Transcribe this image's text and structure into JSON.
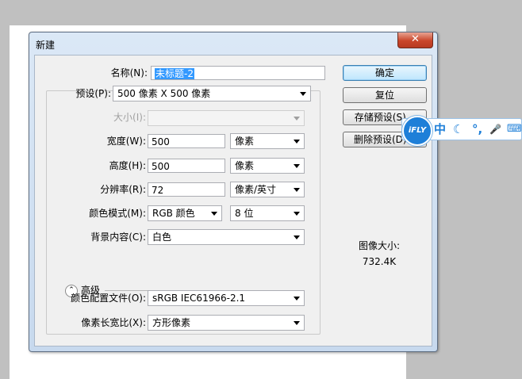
{
  "dialog": {
    "title": "新建",
    "close_glyph": "✕"
  },
  "fields": {
    "name": {
      "label": "名称(N):",
      "value": "未标题-2"
    },
    "preset": {
      "label": "预设(P):",
      "value": "500 像素 X 500 像素"
    },
    "size": {
      "label": "大小(I):",
      "value": ""
    },
    "width": {
      "label": "宽度(W):",
      "value": "500",
      "unit": "像素"
    },
    "height": {
      "label": "高度(H):",
      "value": "500",
      "unit": "像素"
    },
    "resolution": {
      "label": "分辨率(R):",
      "value": "72",
      "unit": "像素/英寸"
    },
    "color_mode": {
      "label": "颜色模式(M):",
      "value": "RGB 颜色",
      "depth": "8 位"
    },
    "background": {
      "label": "背景内容(C):",
      "value": "白色"
    },
    "advanced": {
      "label": "高级",
      "toggle_glyph": "⌃"
    },
    "color_profile": {
      "label": "颜色配置文件(O):",
      "value": "sRGB IEC61966-2.1"
    },
    "pixel_aspect": {
      "label": "像素长宽比(X):",
      "value": "方形像素"
    }
  },
  "buttons": {
    "ok": "确定",
    "reset": "复位",
    "save_preset": "存储预设(S)...",
    "delete_preset": "删除预设(D)..."
  },
  "image_size": {
    "label": "图像大小:",
    "value": "732.4K"
  },
  "ifly_toolbar": {
    "logo": "iFLY",
    "items": [
      "中",
      "☾",
      "°,",
      "🎤",
      "⌨"
    ]
  }
}
